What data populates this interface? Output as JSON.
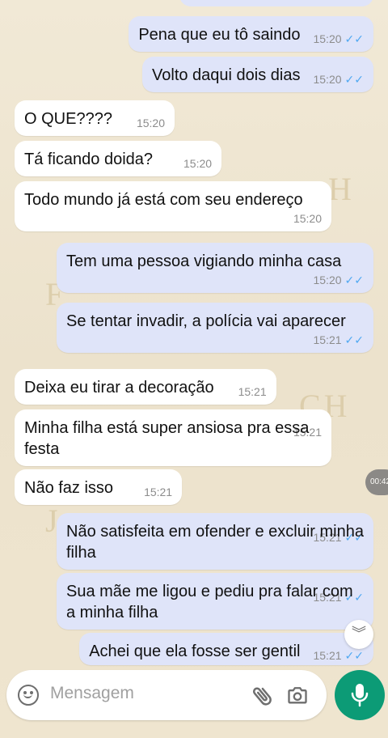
{
  "chat": {
    "messages": [
      {
        "id": "m1",
        "dir": "out",
        "text": "Pena que eu tô saindo",
        "time": "15:20",
        "status": "read"
      },
      {
        "id": "m2",
        "dir": "out",
        "text": "Volto daqui dois dias",
        "time": "15:20",
        "status": "read"
      },
      {
        "id": "m3",
        "dir": "in",
        "text": "O QUE????",
        "time": "15:20"
      },
      {
        "id": "m4",
        "dir": "in",
        "text": "Tá ficando doida?",
        "time": "15:20"
      },
      {
        "id": "m5",
        "dir": "in",
        "text": "Todo mundo já está com seu endereço",
        "time": "15:20"
      },
      {
        "id": "m6",
        "dir": "out",
        "text": "Tem uma pessoa vigiando minha casa",
        "time": "15:20",
        "status": "read"
      },
      {
        "id": "m7",
        "dir": "out",
        "text": "Se tentar invadir, a polícia vai aparecer",
        "time": "15:21",
        "status": "read"
      },
      {
        "id": "m8",
        "dir": "in",
        "text": "Deixa eu tirar a decoração",
        "time": "15:21"
      },
      {
        "id": "m9",
        "dir": "in",
        "text": "Minha filha está super ansiosa pra essa festa",
        "time": "15:21"
      },
      {
        "id": "m10",
        "dir": "in",
        "text": "Não faz isso",
        "time": "15:21"
      },
      {
        "id": "m11",
        "dir": "out",
        "text": "Não satisfeita em ofender e excluir minha filha",
        "time": "15:21",
        "status": "read"
      },
      {
        "id": "m12",
        "dir": "out",
        "text": "Sua mãe me ligou e pediu pra falar com a minha filha",
        "time": "15:21",
        "status": "read"
      },
      {
        "id": "m13",
        "dir": "out",
        "text": "Achei que ela fosse ser gentil",
        "time": "15:21",
        "status": "read"
      }
    ]
  },
  "ticks_glyph": "✓✓",
  "media_badge": "00:42",
  "scroll_glyph": "︾",
  "composer": {
    "placeholder": "Mensagem",
    "icons": {
      "emoji": "emoji-icon",
      "attach": "paperclip-icon",
      "camera": "camera-icon",
      "mic": "microphone-icon"
    }
  },
  "colors": {
    "incoming": "#ffffff",
    "outgoing": "#dfe4f9",
    "ticks": "#4fa8f2",
    "accent": "#0c9b76"
  }
}
